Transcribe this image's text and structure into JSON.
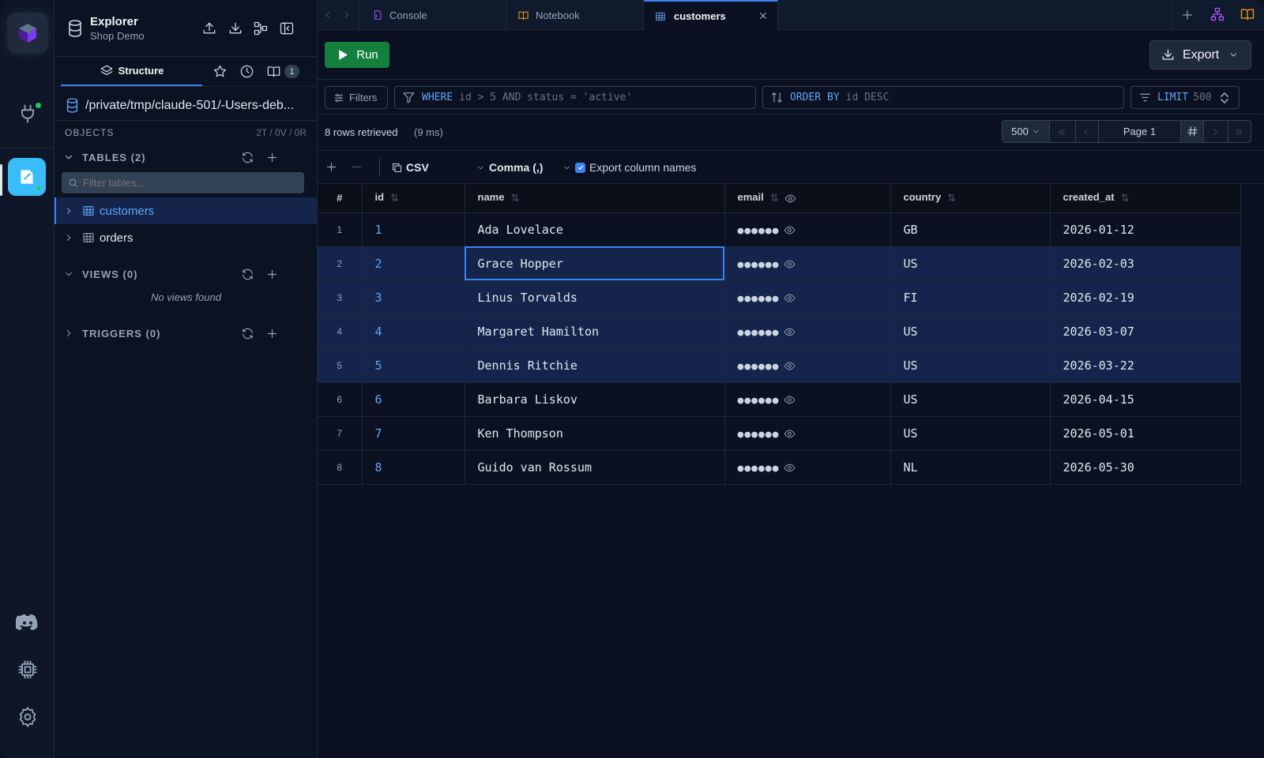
{
  "tabs": [
    {
      "label": "Console",
      "icon": "console-file-icon",
      "active": false
    },
    {
      "label": "Notebook",
      "icon": "book-icon",
      "active": false
    },
    {
      "label": "customers",
      "icon": "table-icon",
      "active": true
    }
  ],
  "explorer": {
    "title": "Explorer",
    "subtitle": "Shop Demo",
    "tab_structure": "Structure",
    "badge_count": "1",
    "db_path": "/private/tmp/claude-501/-Users-deb...",
    "objects_label": "OBJECTS",
    "objects_counts": "2T / 0V / 0R",
    "tables_label": "TABLES (2)",
    "filter_placeholder": "Filter tables...",
    "tables": [
      "customers",
      "orders"
    ],
    "views_label": "VIEWS (0)",
    "no_views": "No views found",
    "triggers_label": "TRIGGERS (0)"
  },
  "toolbar": {
    "run_label": "Run",
    "export_label": "Export"
  },
  "query": {
    "filters_label": "Filters",
    "where_kw": "WHERE",
    "where_expr": "id > 5 AND status = 'active'",
    "order_kw": "ORDER BY",
    "order_expr": "id DESC",
    "limit_kw": "LIMIT",
    "limit_value": "500"
  },
  "status": {
    "rows_text": "8 rows retrieved",
    "time_text": "(9 ms)",
    "page_size": "500",
    "page_label": "Page 1"
  },
  "export_bar": {
    "format": "CSV",
    "delimiter": "Comma (,)",
    "export_names_label": "Export column names",
    "export_names_checked": true
  },
  "grid": {
    "columns": [
      "#",
      "id",
      "name",
      "email",
      "country",
      "created_at"
    ],
    "rows": [
      {
        "n": "1",
        "id": "1",
        "name": "Ada Lovelace",
        "email": "●●●●●●",
        "country": "GB",
        "created_at": "2026-01-12"
      },
      {
        "n": "2",
        "id": "2",
        "name": "Grace Hopper",
        "email": "●●●●●●",
        "country": "US",
        "created_at": "2026-02-03"
      },
      {
        "n": "3",
        "id": "3",
        "name": "Linus Torvalds",
        "email": "●●●●●●",
        "country": "FI",
        "created_at": "2026-02-19"
      },
      {
        "n": "4",
        "id": "4",
        "name": "Margaret Hamilton",
        "email": "●●●●●●",
        "country": "US",
        "created_at": "2026-03-07"
      },
      {
        "n": "5",
        "id": "5",
        "name": "Dennis Ritchie",
        "email": "●●●●●●",
        "country": "US",
        "created_at": "2026-03-22"
      },
      {
        "n": "6",
        "id": "6",
        "name": "Barbara Liskov",
        "email": "●●●●●●",
        "country": "US",
        "created_at": "2026-04-15"
      },
      {
        "n": "7",
        "id": "7",
        "name": "Ken Thompson",
        "email": "●●●●●●",
        "country": "US",
        "created_at": "2026-05-01"
      },
      {
        "n": "8",
        "id": "8",
        "name": "Guido van Rossum",
        "email": "●●●●●●",
        "country": "NL",
        "created_at": "2026-05-30"
      }
    ]
  },
  "colors": {
    "accent": "#3b82f6",
    "run_green": "#16a34a",
    "app_teal": "#38bdf8",
    "keyword_blue": "#60a5fa"
  }
}
